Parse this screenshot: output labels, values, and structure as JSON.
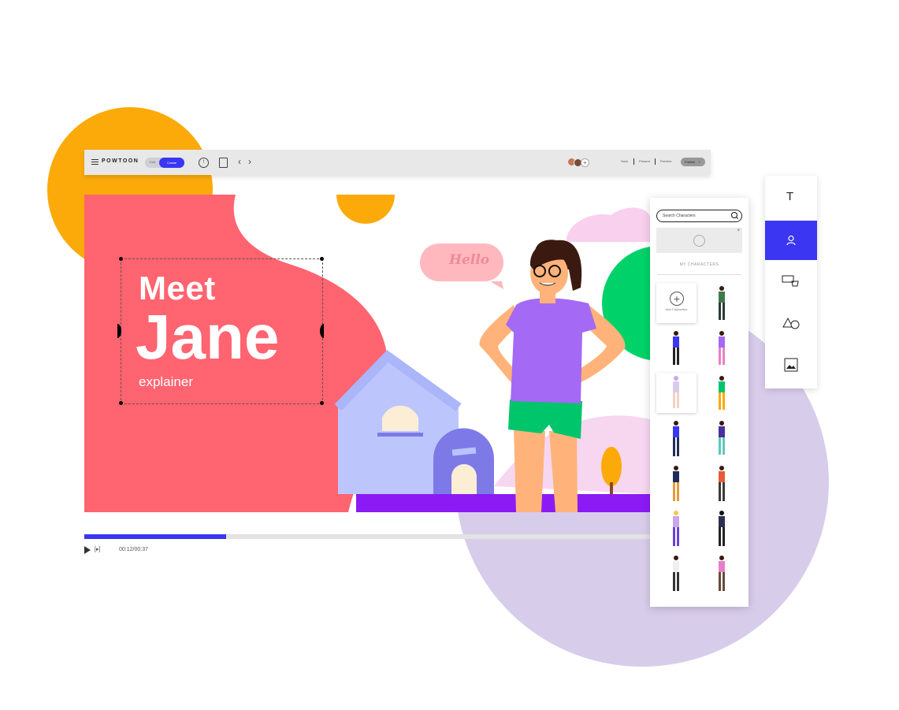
{
  "toolbar": {
    "logo": "POWTOON",
    "mode_edit": "Edit",
    "mode_create": "Create",
    "info": "!",
    "links": [
      "Save",
      "Present",
      "Preview"
    ],
    "publish": "Publish"
  },
  "canvas": {
    "title_line1": "Meet",
    "title_line2": "Jane",
    "subtitle": "explainer",
    "speech_bubble": "Hello"
  },
  "player": {
    "time": "00:12/00:37",
    "progress": 0.25
  },
  "characters_panel": {
    "search_placeholder": "Search Characters",
    "section_label": "MY CHARACTERS",
    "add_label": "Add Characters"
  },
  "tool_rail": [
    "text-tool",
    "characters-tool",
    "props-tool",
    "shapes-tool",
    "media-tool"
  ],
  "colors": {
    "accent": "#3A36F2",
    "coral": "#FF6470",
    "orange": "#FCAA0A",
    "lilac": "#D8CCEB",
    "green": "#00D26A",
    "purple": "#8B1AF5"
  }
}
